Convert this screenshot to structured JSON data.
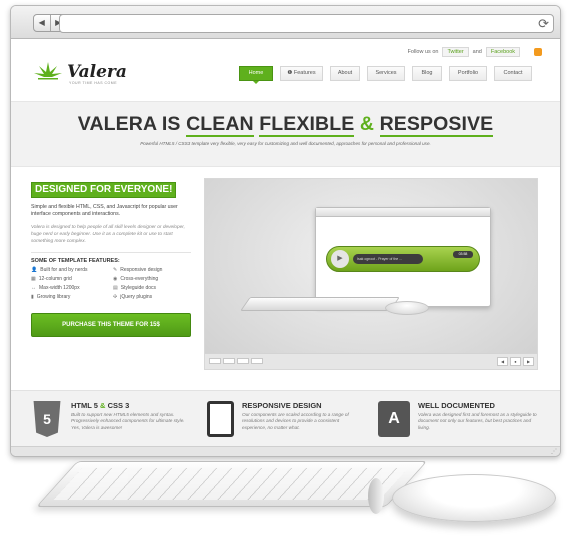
{
  "topbar": {
    "follow_text": "Follow us on",
    "twitter": "Twitter",
    "and_text": "and",
    "facebook": "Facebook"
  },
  "logo": {
    "name": "Valera",
    "tagline": "YOUR TIME HAS COME"
  },
  "nav": {
    "items": [
      {
        "label": "Home",
        "active": true
      },
      {
        "label": "Features",
        "active": false
      },
      {
        "label": "About",
        "active": false
      },
      {
        "label": "Services",
        "active": false
      },
      {
        "label": "Blog",
        "active": false
      },
      {
        "label": "Portfolio",
        "active": false
      },
      {
        "label": "Contact",
        "active": false
      }
    ]
  },
  "hero": {
    "title_part1": "VALERA IS",
    "title_clean": "CLEAN",
    "title_flexible": "FLEXIBLE",
    "title_amp": "&",
    "title_responsive": "RESPOSIVE",
    "subtitle": "Powerful HTML5 / CSS3 template very flexible, very easy for customizing and well documented, approaches for personal and professional use."
  },
  "left": {
    "badge": "DESIGNED FOR EVERYONE!",
    "intro": "Simple and flexible HTML, CSS, and Javascript for popular user interface components and interactions.",
    "intro2": "Valera is designed to help people of all skill levels designer or developer, huge nerd or early beginner. Use it as a complete kit or use to start something more complex.",
    "features_title": "SOME OF TEMPLATE FEATURES:",
    "features": [
      "Built for and by nerds",
      "Responsive design",
      "12-column grid",
      "Cross-everything",
      "Max-width 1200px",
      "Styleguide docs",
      "Growing library",
      "jQuery plugins"
    ],
    "purchase_label": "PURCHASE THIS THEME FOR 15$"
  },
  "slider": {
    "track_text": "Isak ognoot - Prayer of the ...",
    "time": "03:58",
    "arrows": [
      "◀",
      "●",
      "▶"
    ]
  },
  "bottom": {
    "col1": {
      "title_a": "HTML 5",
      "amp": "&",
      "title_b": "CSS 3",
      "icon_text": "5",
      "text": "Built to support new HTML5 elements and syntax. Progressively enhanced components for ultimate style. Yes, Valera is awesome!"
    },
    "col2": {
      "title": "RESPONSIVE DESIGN",
      "text": "Our components are scaled according to a range of resolutions and devices to provide a consistent experience, no matter what."
    },
    "col3": {
      "title": "WELL DOCUMENTED",
      "icon_text": "A",
      "text": "Valera was designed first and foremost as a styleguide to document not only our features, but best practices and living."
    }
  },
  "colors": {
    "accent": "#5fb01d",
    "text_dark": "#333333",
    "hero_bg": "#f2f2f2"
  }
}
